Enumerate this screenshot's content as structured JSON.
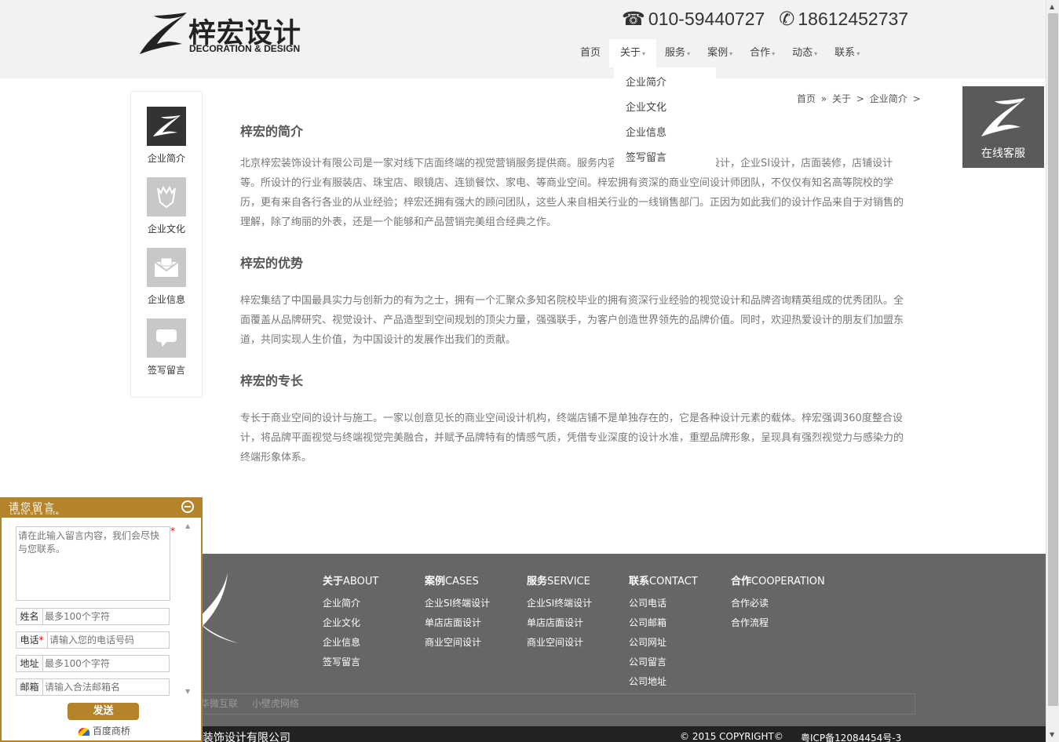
{
  "header": {
    "logo_cn": "梓宏设计",
    "logo_en": "DECORATION & DESIGN",
    "phone1": "010-59440727",
    "phone2": "18612452737"
  },
  "nav": {
    "items": [
      "首页",
      "关于",
      "服务",
      "案例",
      "合作",
      "动态",
      "联系"
    ],
    "dropdown": [
      "企业简介",
      "企业文化",
      "企业信息",
      "签写留言"
    ]
  },
  "sidebar": {
    "items": [
      "企业简介",
      "企业文化",
      "企业信息",
      "签写留言"
    ]
  },
  "breadcrumb": {
    "home": "首页",
    "sep1": "»",
    "about": "关于",
    "sep2": ">",
    "current": "企业简介",
    "sep3": ">"
  },
  "content": {
    "h1": "梓宏的简介",
    "p1": "北京梓宏装饰设计有限公司是一家对线下店面终端的视觉营销服务提供商。服务内容包括：品牌终端形象设计，企业SI设计，店面装修，店铺设计等。所设计的行业有服装店、珠宝店、眼镜店、连锁餐饮、家电、等商业空间。梓宏拥有资深的商业空间设计师团队，不仅仅有知名高等院校的学历，更有来自各行各业的从业经验；梓宏还拥有强大的顾问团队，这些人来自相关行业的一线销售部门。正因为如此我们的设计作品来自于对销售的理解，除了绚丽的外表，还是一个能够和产品营销完美组合经典之作。",
    "h2": "梓宏的优势",
    "p2": "梓宏集结了中国最具实力与创新力的有为之士，拥有一个汇聚众多知名院校毕业的拥有资深行业经验的视觉设计和品牌咨询精英组成的优秀团队。全面覆盖从品牌研究、视觉设计、产品造型到空间规划的顶尖力量，强强联手，为客户创造世界领先的品牌价值。同时，欢迎热爱设计的朋友们加盟东道，共同实现人生价值，为中国设计的发展作出我们的贡献。",
    "h3": "梓宏的专长",
    "p3": "专长于商业空间的设计与施工。一家以创意见长的商业空间设计机构，终端店铺不是单独存在的，它是各种设计元素的载体。梓宏强调360度整合设计，将品牌平面视觉与终端视觉完美融合，并赋予品牌特有的情感气质，凭借专业深度的设计水准，重塑品牌形象，呈现具有强烈视觉力与感染力的终端形象体系。"
  },
  "kefu": {
    "label": "在线客服"
  },
  "footer": {
    "cols": [
      {
        "b": "关于",
        "en": "ABOUT",
        "items": [
          "企业简介",
          "企业文化",
          "企业信息",
          "签写留言"
        ]
      },
      {
        "b": "案例",
        "en": "CASES",
        "items": [
          "企业SI终端设计",
          "单店店面设计",
          "商业空间设计"
        ]
      },
      {
        "b": "服务",
        "en": "SERVICE",
        "items": [
          "企业SI终端设计",
          "单店店面设计",
          "商业空间设计"
        ]
      },
      {
        "b": "联系",
        "en": "CONTACT",
        "items": [
          "公司电话",
          "公司邮箱",
          "公司网址",
          "公司留言",
          "公司地址"
        ]
      },
      {
        "b": "合作",
        "en": "COOPERATION",
        "items": [
          "合作必读",
          "合作流程"
        ]
      }
    ],
    "links": [
      "华微互联",
      "小壁虎网络"
    ],
    "company": "装饰设计有限公司",
    "copyright": "© 2015 COPYRIGHT©",
    "icp": "粤ICP备12084454号-3"
  },
  "message": {
    "title": "请您留言",
    "subtitle": "Leave us a note",
    "content_placeholder": "请在此输入留言内容，我们会尽快与您联系。",
    "name_label": "姓名",
    "name_placeholder": "最多100个字符",
    "phone_label": "电话",
    "phone_placeholder": "请输入您的电话号码",
    "addr_label": "地址",
    "addr_placeholder": "最多100个字符",
    "email_label": "邮箱",
    "email_placeholder": "请输入合法邮箱名",
    "send": "发送",
    "baidu": "百度商桥"
  }
}
